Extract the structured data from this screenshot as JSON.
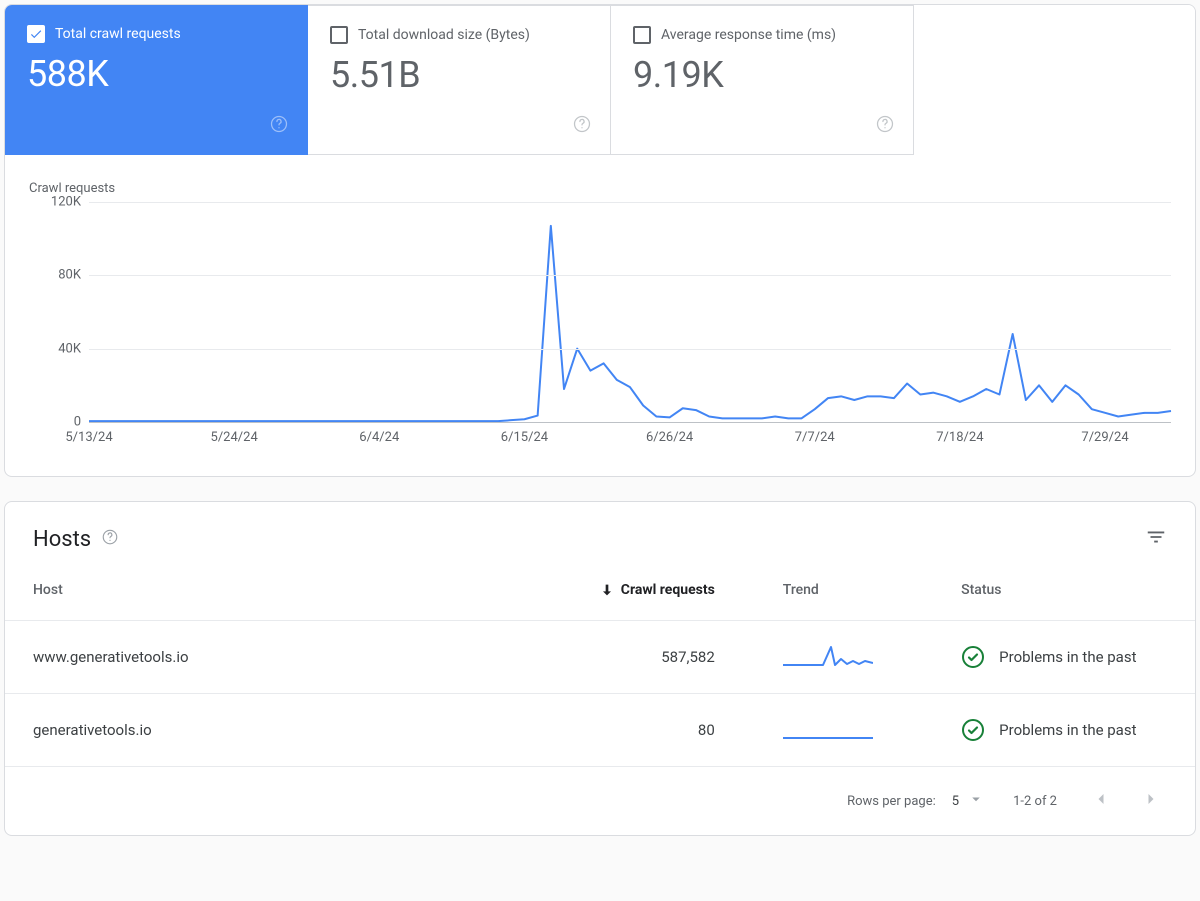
{
  "metrics": [
    {
      "label": "Total crawl requests",
      "value": "588K",
      "active": true
    },
    {
      "label": "Total download size (Bytes)",
      "value": "5.51B",
      "active": false
    },
    {
      "label": "Average response time (ms)",
      "value": "9.19K",
      "active": false
    }
  ],
  "chart_data": {
    "type": "line",
    "title": "Crawl requests",
    "ylabel": "",
    "xlabel": "",
    "ylim": [
      0,
      120000
    ],
    "y_ticks": [
      0,
      40000,
      80000,
      120000
    ],
    "y_tick_labels": [
      "0",
      "40K",
      "80K",
      "120K"
    ],
    "x_ticks_i": [
      0,
      11,
      22,
      33,
      44,
      55,
      66,
      77
    ],
    "x_tick_labels": [
      "5/13/24",
      "5/24/24",
      "6/4/24",
      "6/15/24",
      "6/26/24",
      "7/7/24",
      "7/18/24",
      "7/29/24"
    ],
    "series": [
      {
        "name": "Total crawl requests",
        "color": "#4285f4",
        "values": [
          500,
          500,
          500,
          500,
          500,
          500,
          500,
          500,
          500,
          500,
          500,
          500,
          500,
          500,
          500,
          500,
          500,
          500,
          500,
          500,
          500,
          500,
          500,
          500,
          500,
          500,
          500,
          500,
          500,
          500,
          500,
          500,
          1000,
          1500,
          3500,
          107000,
          18000,
          40000,
          28000,
          32000,
          23000,
          19000,
          9000,
          3000,
          2500,
          7500,
          6500,
          3000,
          2000,
          2000,
          2000,
          2000,
          3000,
          2000,
          2000,
          7000,
          13000,
          14000,
          12000,
          14000,
          14000,
          13000,
          21000,
          15000,
          16000,
          14000,
          11000,
          14000,
          18000,
          15000,
          48000,
          12000,
          20000,
          11000,
          20000,
          15000,
          7000,
          5000,
          3000,
          4000,
          5000,
          5000,
          6000
        ]
      }
    ]
  },
  "hosts_section": {
    "title": "Hosts",
    "columns": {
      "host": "Host",
      "requests": "Crawl requests",
      "trend": "Trend",
      "status": "Status"
    },
    "rows": [
      {
        "host": "www.generativetools.io",
        "requests": "587,582",
        "status": "Problems in the past",
        "spark": "peak"
      },
      {
        "host": "generativetools.io",
        "requests": "80",
        "status": "Problems in the past",
        "spark": "flat"
      }
    ],
    "footer": {
      "rows_per_page_label": "Rows per page:",
      "rows_per_page_value": "5",
      "range": "1-2 of 2"
    }
  }
}
